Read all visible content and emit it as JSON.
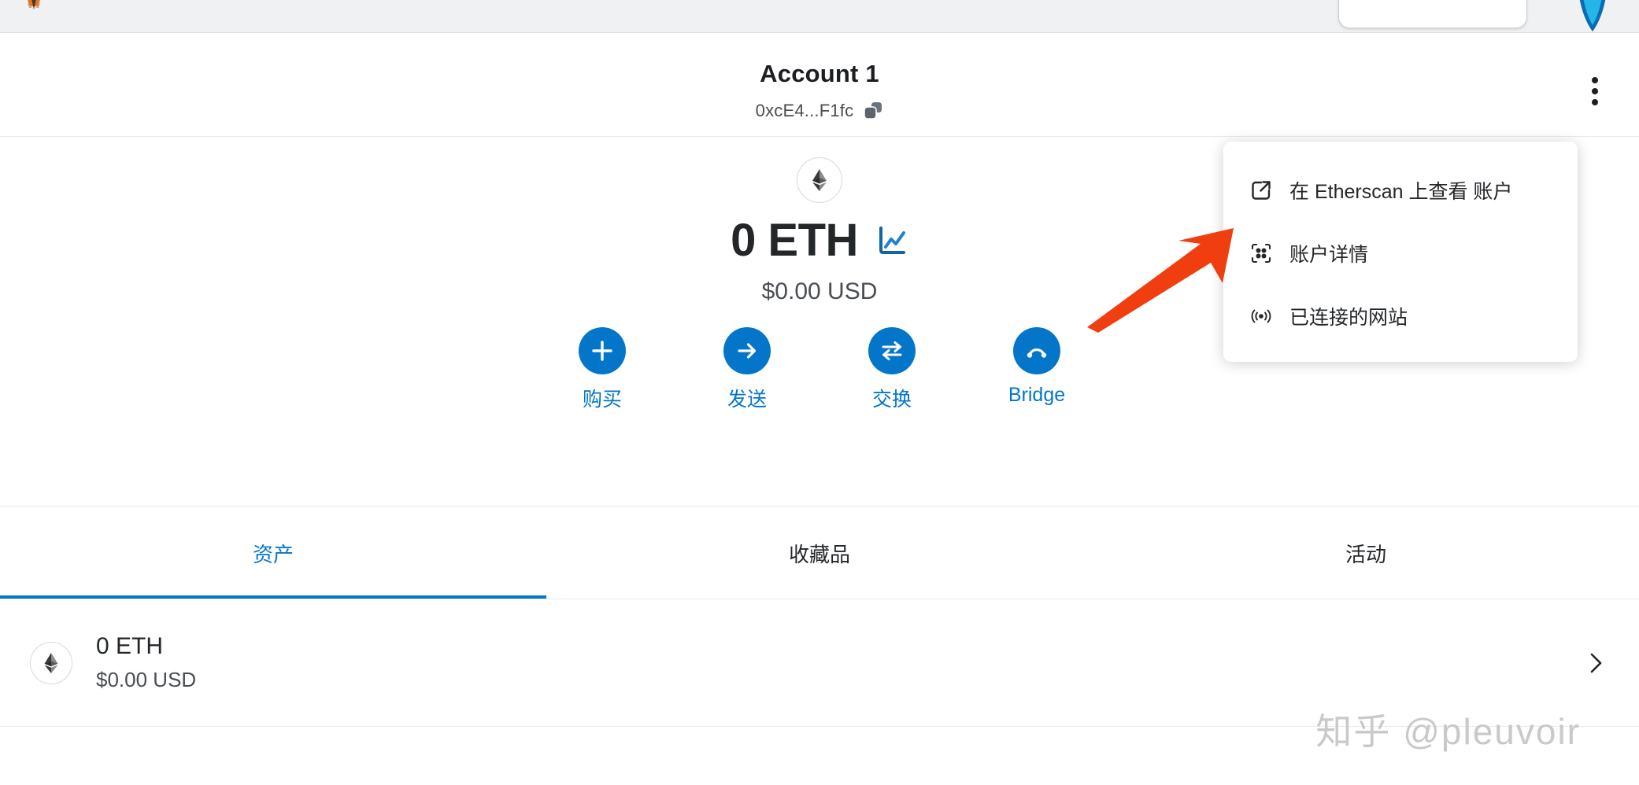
{
  "browser": {
    "firefox_icon": "firefox-logo-icon",
    "url_field_value": "",
    "extension_icon": "browser-extension-icon"
  },
  "account": {
    "name": "Account 1",
    "address": "0xcE4...F1fc",
    "copy_icon": "copy-icon",
    "menu_icon": "kebab-menu-icon"
  },
  "balance": {
    "token_icon": "ethereum-icon",
    "amount": "0 ETH",
    "fiat": "$0.00 USD",
    "portfolio_icon": "line-chart-icon"
  },
  "actions": [
    {
      "label": "购买",
      "icon": "plus-icon"
    },
    {
      "label": "发送",
      "icon": "arrow-right-icon"
    },
    {
      "label": "交换",
      "icon": "swap-arrows-icon"
    },
    {
      "label": "Bridge",
      "icon": "bridge-arc-icon"
    }
  ],
  "tabs": [
    {
      "label": "资产",
      "active": true
    },
    {
      "label": "收藏品",
      "active": false
    },
    {
      "label": "活动",
      "active": false
    }
  ],
  "assets": [
    {
      "icon": "ethereum-icon",
      "amount": "0 ETH",
      "fiat": "$0.00 USD",
      "chevron": "chevron-right-icon"
    }
  ],
  "dropdown": {
    "items": [
      {
        "label": "在 Etherscan 上查看 账户",
        "icon": "external-link-icon"
      },
      {
        "label": "账户详情",
        "icon": "qr-code-icon"
      },
      {
        "label": "已连接的网站",
        "icon": "broadcast-icon"
      }
    ]
  },
  "annotation": {
    "arrow_color": "#F03E10",
    "points_to": "账户详情"
  },
  "watermark": {
    "text": "知乎 @pleuvoir"
  },
  "colors": {
    "primary_blue": "#0376C9",
    "text_dark": "#24272A",
    "text_muted": "#4A4D54",
    "border": "#E9E9EB",
    "chrome_bg": "#F0F1F3",
    "annotation": "#F03E10"
  }
}
